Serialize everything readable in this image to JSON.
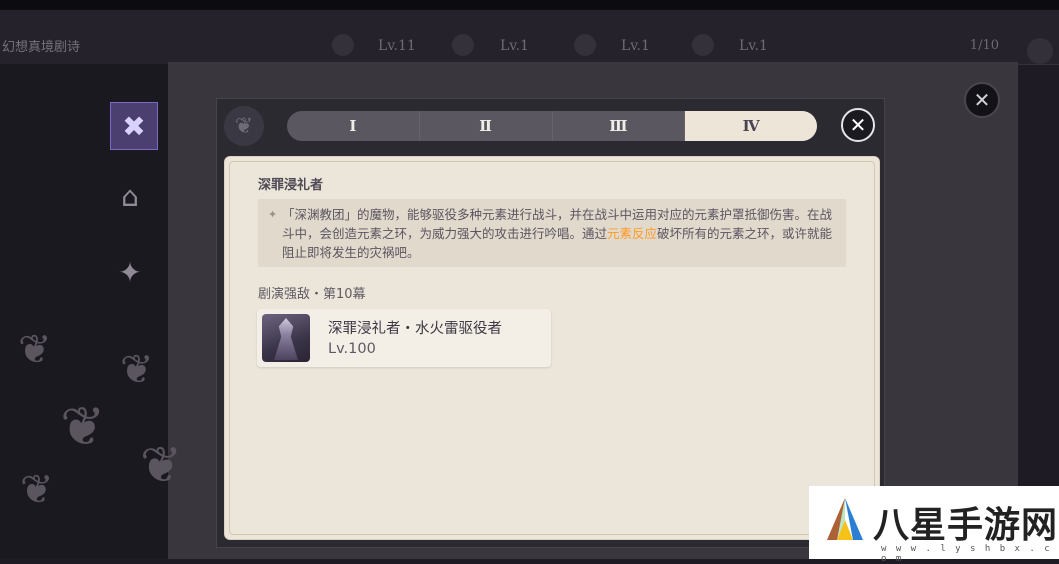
{
  "topbar": {
    "title": "幻想真境剧诗",
    "levels": [
      "Lv.11",
      "Lv.1",
      "Lv.1",
      "Lv.1"
    ],
    "count": "1/10"
  },
  "popup": {
    "tabs": [
      {
        "label": "Ⅰ",
        "active": false
      },
      {
        "label": "Ⅱ",
        "active": false
      },
      {
        "label": "Ⅲ",
        "active": false
      },
      {
        "label": "Ⅳ",
        "active": true
      }
    ],
    "close_icon": "close-icon",
    "enemy_name": "深罪浸礼者",
    "description": {
      "part1": "「深渊教团」的魔物，能够驱役多种元素进行战斗，并在战斗中运用对应的元素护罩抵御伤害。在战斗中，会创造元素之环，为威力强大的攻击进行吟唱。通过",
      "highlight": "元素反应",
      "part2": "破坏所有的元素之环，或许就能阻止即将发生的灾祸吧。"
    },
    "highlight_color": "#ff9b26",
    "section_title": "剧演强敌・第10幕",
    "enemy_card": {
      "title": "深罪浸礼者・水火雷驱役者",
      "level": "Lv.100"
    }
  },
  "watermark": {
    "brand": "八星手游网",
    "url": "w w w . l y s h b x . c o m"
  }
}
